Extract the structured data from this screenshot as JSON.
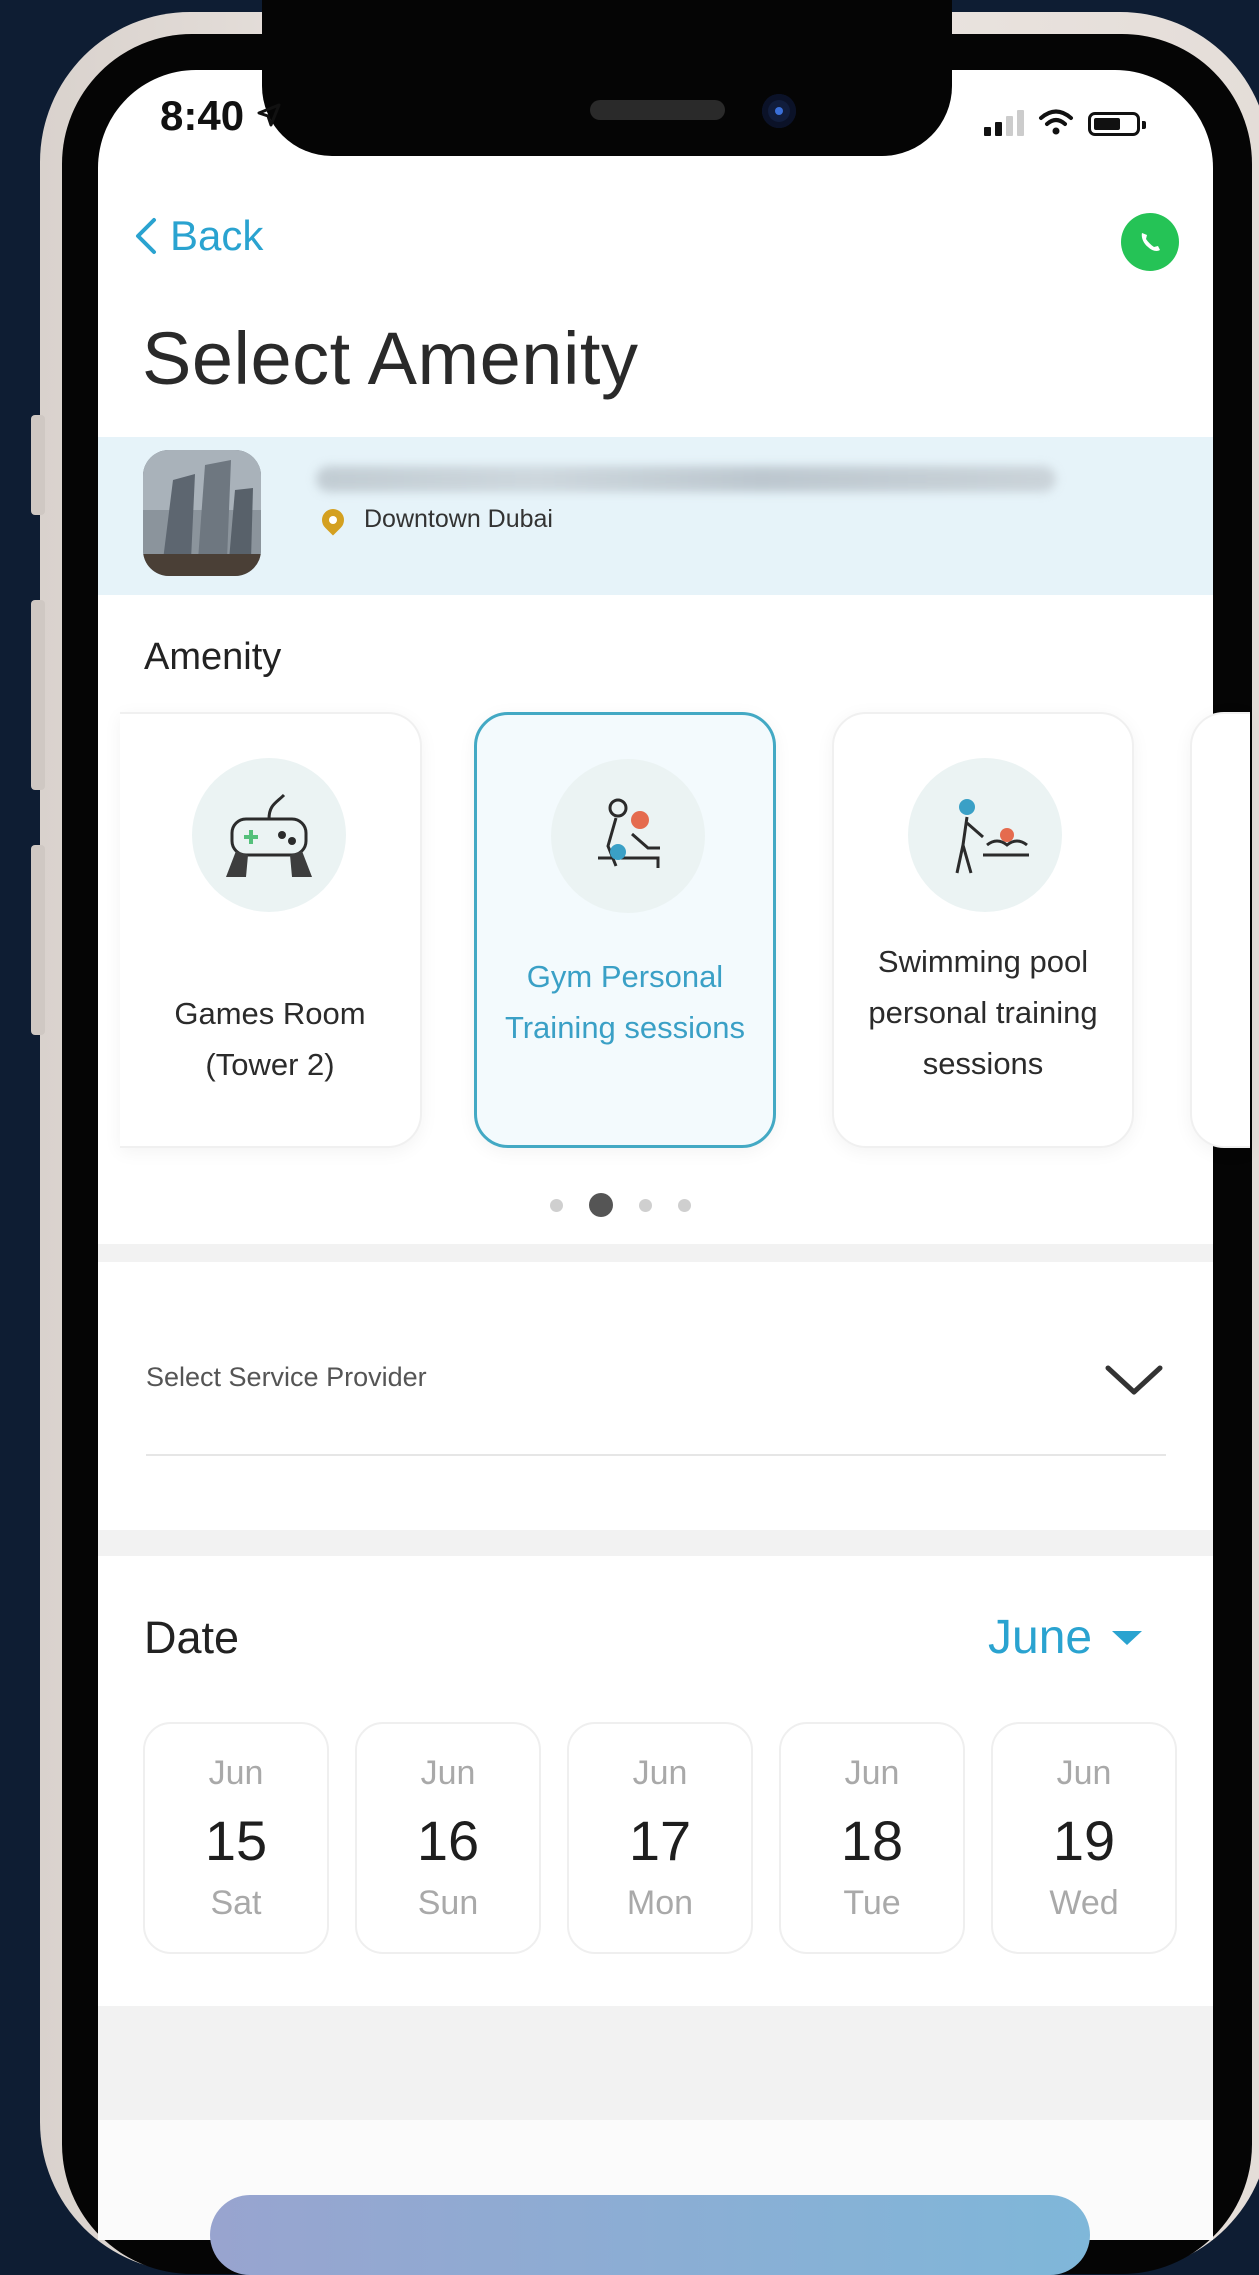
{
  "status_bar": {
    "time": "8:40"
  },
  "nav": {
    "back_label": "Back"
  },
  "page_title": "Select Amenity",
  "property": {
    "location": "Downtown Dubai"
  },
  "amenity": {
    "section_label": "Amenity",
    "cards": [
      {
        "label": "Games Room (Tower 2)",
        "icon": "game-controller-icon",
        "selected": false
      },
      {
        "label": "Gym Personal Training sessions",
        "icon": "personal-trainer-icon",
        "selected": true
      },
      {
        "label": "Swimming pool personal training sessions",
        "icon": "swim-trainer-icon",
        "selected": false
      }
    ],
    "carousel_pages": 4,
    "carousel_active": 2
  },
  "service_provider": {
    "placeholder": "Select Service Provider"
  },
  "date": {
    "section_label": "Date",
    "month": "June",
    "days": [
      {
        "month": "Jun",
        "day": "15",
        "weekday": "Sat"
      },
      {
        "month": "Jun",
        "day": "16",
        "weekday": "Sun"
      },
      {
        "month": "Jun",
        "day": "17",
        "weekday": "Mon"
      },
      {
        "month": "Jun",
        "day": "18",
        "weekday": "Tue"
      },
      {
        "month": "Jun",
        "day": "19",
        "weekday": "Wed"
      }
    ]
  },
  "colors": {
    "accent": "#2aa3d0",
    "selected_border": "#43a9c4",
    "property_bar": "#e6f3f9",
    "whatsapp": "#25c356",
    "pin": "#d4a020"
  }
}
